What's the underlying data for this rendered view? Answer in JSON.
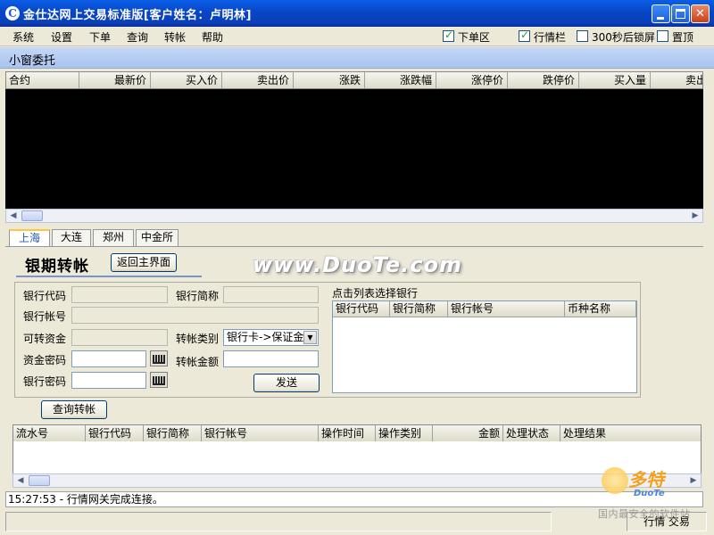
{
  "window": {
    "app_icon_glyph": "C",
    "title": "金仕达网上交易标准版[客户姓名：卢明林]"
  },
  "menu": {
    "items": [
      "系统",
      "设置",
      "下单",
      "查询",
      "转帐",
      "帮助"
    ],
    "checks": [
      {
        "label": "下单区",
        "checked": true
      },
      {
        "label": "行情栏",
        "checked": true
      },
      {
        "label": "300秒后锁屏",
        "checked": false
      },
      {
        "label": "置顶",
        "checked": false
      }
    ]
  },
  "band": {
    "label": "小窗委托"
  },
  "quote_table": {
    "columns": [
      "合约",
      "最新价",
      "买入价",
      "卖出价",
      "涨跌",
      "涨跌幅",
      "涨停价",
      "跌停价",
      "买入量",
      "卖出量"
    ]
  },
  "exchange_tabs": [
    "上海",
    "大连",
    "郑州",
    "中金所"
  ],
  "transfer": {
    "title": "银期转帐",
    "back_button": "返回主界面",
    "labels": {
      "bank_code": "银行代码",
      "bank_short": "银行简称",
      "bank_account": "银行帐号",
      "available_funds": "可转资金",
      "transfer_type": "转帐类别",
      "fund_password": "资金密码",
      "transfer_amount": "转帐金额",
      "bank_password": "银行密码"
    },
    "transfer_type_value": "银行卡->保证金",
    "send_button": "发送",
    "bank_list_caption": "点击列表选择银行",
    "bank_list_columns": [
      "银行代码",
      "银行简称",
      "银行帐号",
      "币种名称"
    ],
    "query_button": "查询转帐"
  },
  "records_table": {
    "columns": [
      "流水号",
      "银行代码",
      "银行简称",
      "银行帐号",
      "操作时间",
      "操作类别",
      "金额",
      "处理状态",
      "处理结果"
    ]
  },
  "status": {
    "message": "15:27:53 - 行情网关完成连接。",
    "pane_right": "行情 交易"
  },
  "watermark": {
    "site": "www.DuoTe.com",
    "logo_cn": "多特",
    "logo_en": "DuoTe",
    "logo_tagline": "国内最安全的软件站"
  }
}
